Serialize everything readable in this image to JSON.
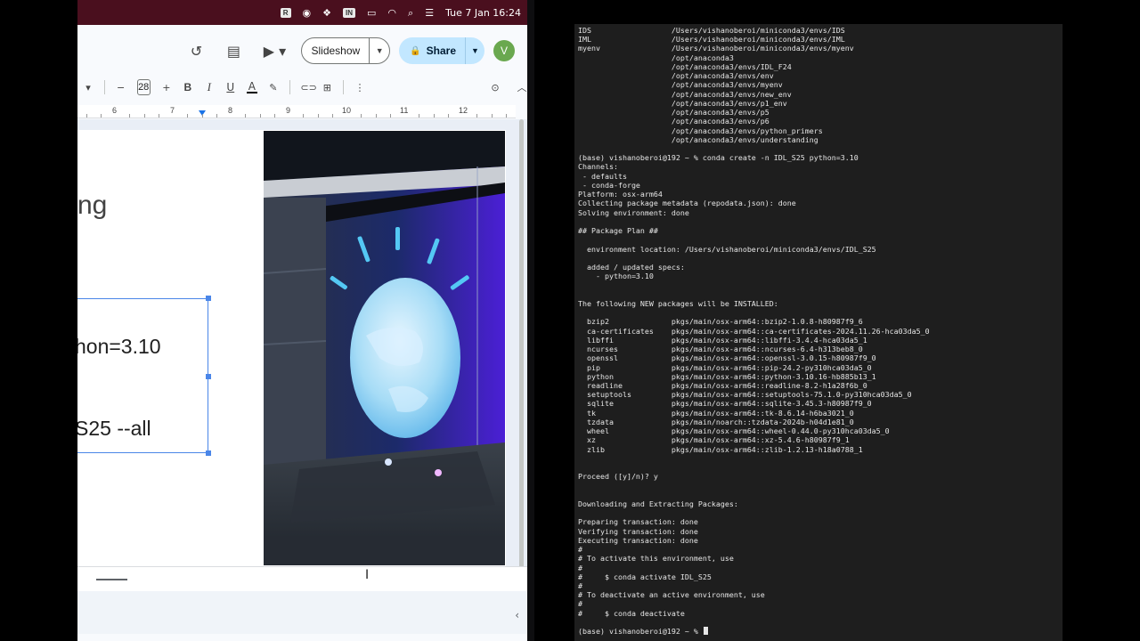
{
  "menubar": {
    "status_badge": "R",
    "input_source": "IN",
    "datetime": "Tue 7 Jan  16:24"
  },
  "slides_header": {
    "slideshow_label": "Slideshow",
    "share_label": "Share",
    "avatar_initial": "V"
  },
  "format_bar": {
    "font_size": "28",
    "bold": "B",
    "italic": "I",
    "underline": "U",
    "text_color": "A"
  },
  "ruler": {
    "numbers": [
      "6",
      "7",
      "8",
      "9",
      "10",
      "11",
      "12"
    ]
  },
  "slide": {
    "title_fragment": "ng",
    "textbox_line1": "hon=3.10",
    "textbox_line2": "S25 --all"
  },
  "colors": {
    "menubar_bg": "#4a0f1e",
    "share_bg": "#c2e7ff",
    "avatar_bg": "#6aa84f",
    "selection_blue": "#4a86e8",
    "terminal_bg": "#1e1e1e"
  },
  "terminal": {
    "lines": [
      "IDS                  /Users/vishanoberoi/miniconda3/envs/IDS",
      "IML                  /Users/vishanoberoi/miniconda3/envs/IML",
      "myenv                /Users/vishanoberoi/miniconda3/envs/myenv",
      "                     /opt/anaconda3",
      "                     /opt/anaconda3/envs/IDL_F24",
      "                     /opt/anaconda3/envs/env",
      "                     /opt/anaconda3/envs/myenv",
      "                     /opt/anaconda3/envs/new_env",
      "                     /opt/anaconda3/envs/p1_env",
      "                     /opt/anaconda3/envs/p5",
      "                     /opt/anaconda3/envs/p6",
      "                     /opt/anaconda3/envs/python_primers",
      "                     /opt/anaconda3/envs/understanding",
      "",
      "(base) vishanoberoi@192 ~ % conda create -n IDL_S25 python=3.10",
      "Channels:",
      " - defaults",
      " - conda-forge",
      "Platform: osx-arm64",
      "Collecting package metadata (repodata.json): done",
      "Solving environment: done",
      "",
      "## Package Plan ##",
      "",
      "  environment location: /Users/vishanoberoi/miniconda3/envs/IDL_S25",
      "",
      "  added / updated specs:",
      "    - python=3.10",
      "",
      "",
      "The following NEW packages will be INSTALLED:",
      "",
      "  bzip2              pkgs/main/osx-arm64::bzip2-1.0.8-h80987f9_6",
      "  ca-certificates    pkgs/main/osx-arm64::ca-certificates-2024.11.26-hca03da5_0",
      "  libffi             pkgs/main/osx-arm64::libffi-3.4.4-hca03da5_1",
      "  ncurses            pkgs/main/osx-arm64::ncurses-6.4-h313beb8_0",
      "  openssl            pkgs/main/osx-arm64::openssl-3.0.15-h80987f9_0",
      "  pip                pkgs/main/osx-arm64::pip-24.2-py310hca03da5_0",
      "  python             pkgs/main/osx-arm64::python-3.10.16-hb885b13_1",
      "  readline           pkgs/main/osx-arm64::readline-8.2-h1a28f6b_0",
      "  setuptools         pkgs/main/osx-arm64::setuptools-75.1.0-py310hca03da5_0",
      "  sqlite             pkgs/main/osx-arm64::sqlite-3.45.3-h80987f9_0",
      "  tk                 pkgs/main/osx-arm64::tk-8.6.14-h6ba3021_0",
      "  tzdata             pkgs/main/noarch::tzdata-2024b-h04d1e81_0",
      "  wheel              pkgs/main/osx-arm64::wheel-0.44.0-py310hca03da5_0",
      "  xz                 pkgs/main/osx-arm64::xz-5.4.6-h80987f9_1",
      "  zlib               pkgs/main/osx-arm64::zlib-1.2.13-h18a0788_1",
      "",
      "",
      "Proceed ([y]/n)? y",
      "",
      "",
      "Downloading and Extracting Packages:",
      "",
      "Preparing transaction: done",
      "Verifying transaction: done",
      "Executing transaction: done",
      "#",
      "# To activate this environment, use",
      "#",
      "#     $ conda activate IDL_S25",
      "#",
      "# To deactivate an active environment, use",
      "#",
      "#     $ conda deactivate",
      "",
      "(base) vishanoberoi@192 ~ % "
    ]
  }
}
